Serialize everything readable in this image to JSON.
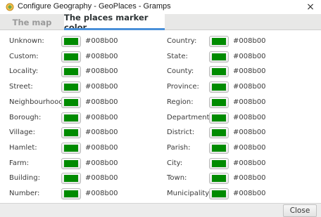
{
  "window": {
    "title": "Configure Geography - GeoPlaces - Gramps",
    "close_glyph": "×",
    "icon": "gramps-app-icon"
  },
  "tabs": [
    {
      "label": "The map",
      "active": false
    },
    {
      "label": "The places marker color",
      "active": true
    }
  ],
  "colors": {
    "marker": "#008b00",
    "tab_accent": "#4a90d9"
  },
  "left_column": [
    {
      "label": "Unknown:",
      "value": "#008b00"
    },
    {
      "label": "Custom:",
      "value": "#008b00"
    },
    {
      "label": "Locality:",
      "value": "#008b00"
    },
    {
      "label": "Street:",
      "value": "#008b00"
    },
    {
      "label": "Neighbourhood:",
      "value": "#008b00"
    },
    {
      "label": "Borough:",
      "value": "#008b00"
    },
    {
      "label": "Village:",
      "value": "#008b00"
    },
    {
      "label": "Hamlet:",
      "value": "#008b00"
    },
    {
      "label": "Farm:",
      "value": "#008b00"
    },
    {
      "label": "Building:",
      "value": "#008b00"
    },
    {
      "label": "Number:",
      "value": "#008b00"
    }
  ],
  "right_column": [
    {
      "label": "Country:",
      "value": "#008b00"
    },
    {
      "label": "State:",
      "value": "#008b00"
    },
    {
      "label": "County:",
      "value": "#008b00"
    },
    {
      "label": "Province:",
      "value": "#008b00"
    },
    {
      "label": "Region:",
      "value": "#008b00"
    },
    {
      "label": "Department:",
      "value": "#008b00"
    },
    {
      "label": "District:",
      "value": "#008b00"
    },
    {
      "label": "Parish:",
      "value": "#008b00"
    },
    {
      "label": "City:",
      "value": "#008b00"
    },
    {
      "label": "Town:",
      "value": "#008b00"
    },
    {
      "label": "Municipality:",
      "value": "#008b00"
    }
  ],
  "footer": {
    "close_label": "Close"
  }
}
